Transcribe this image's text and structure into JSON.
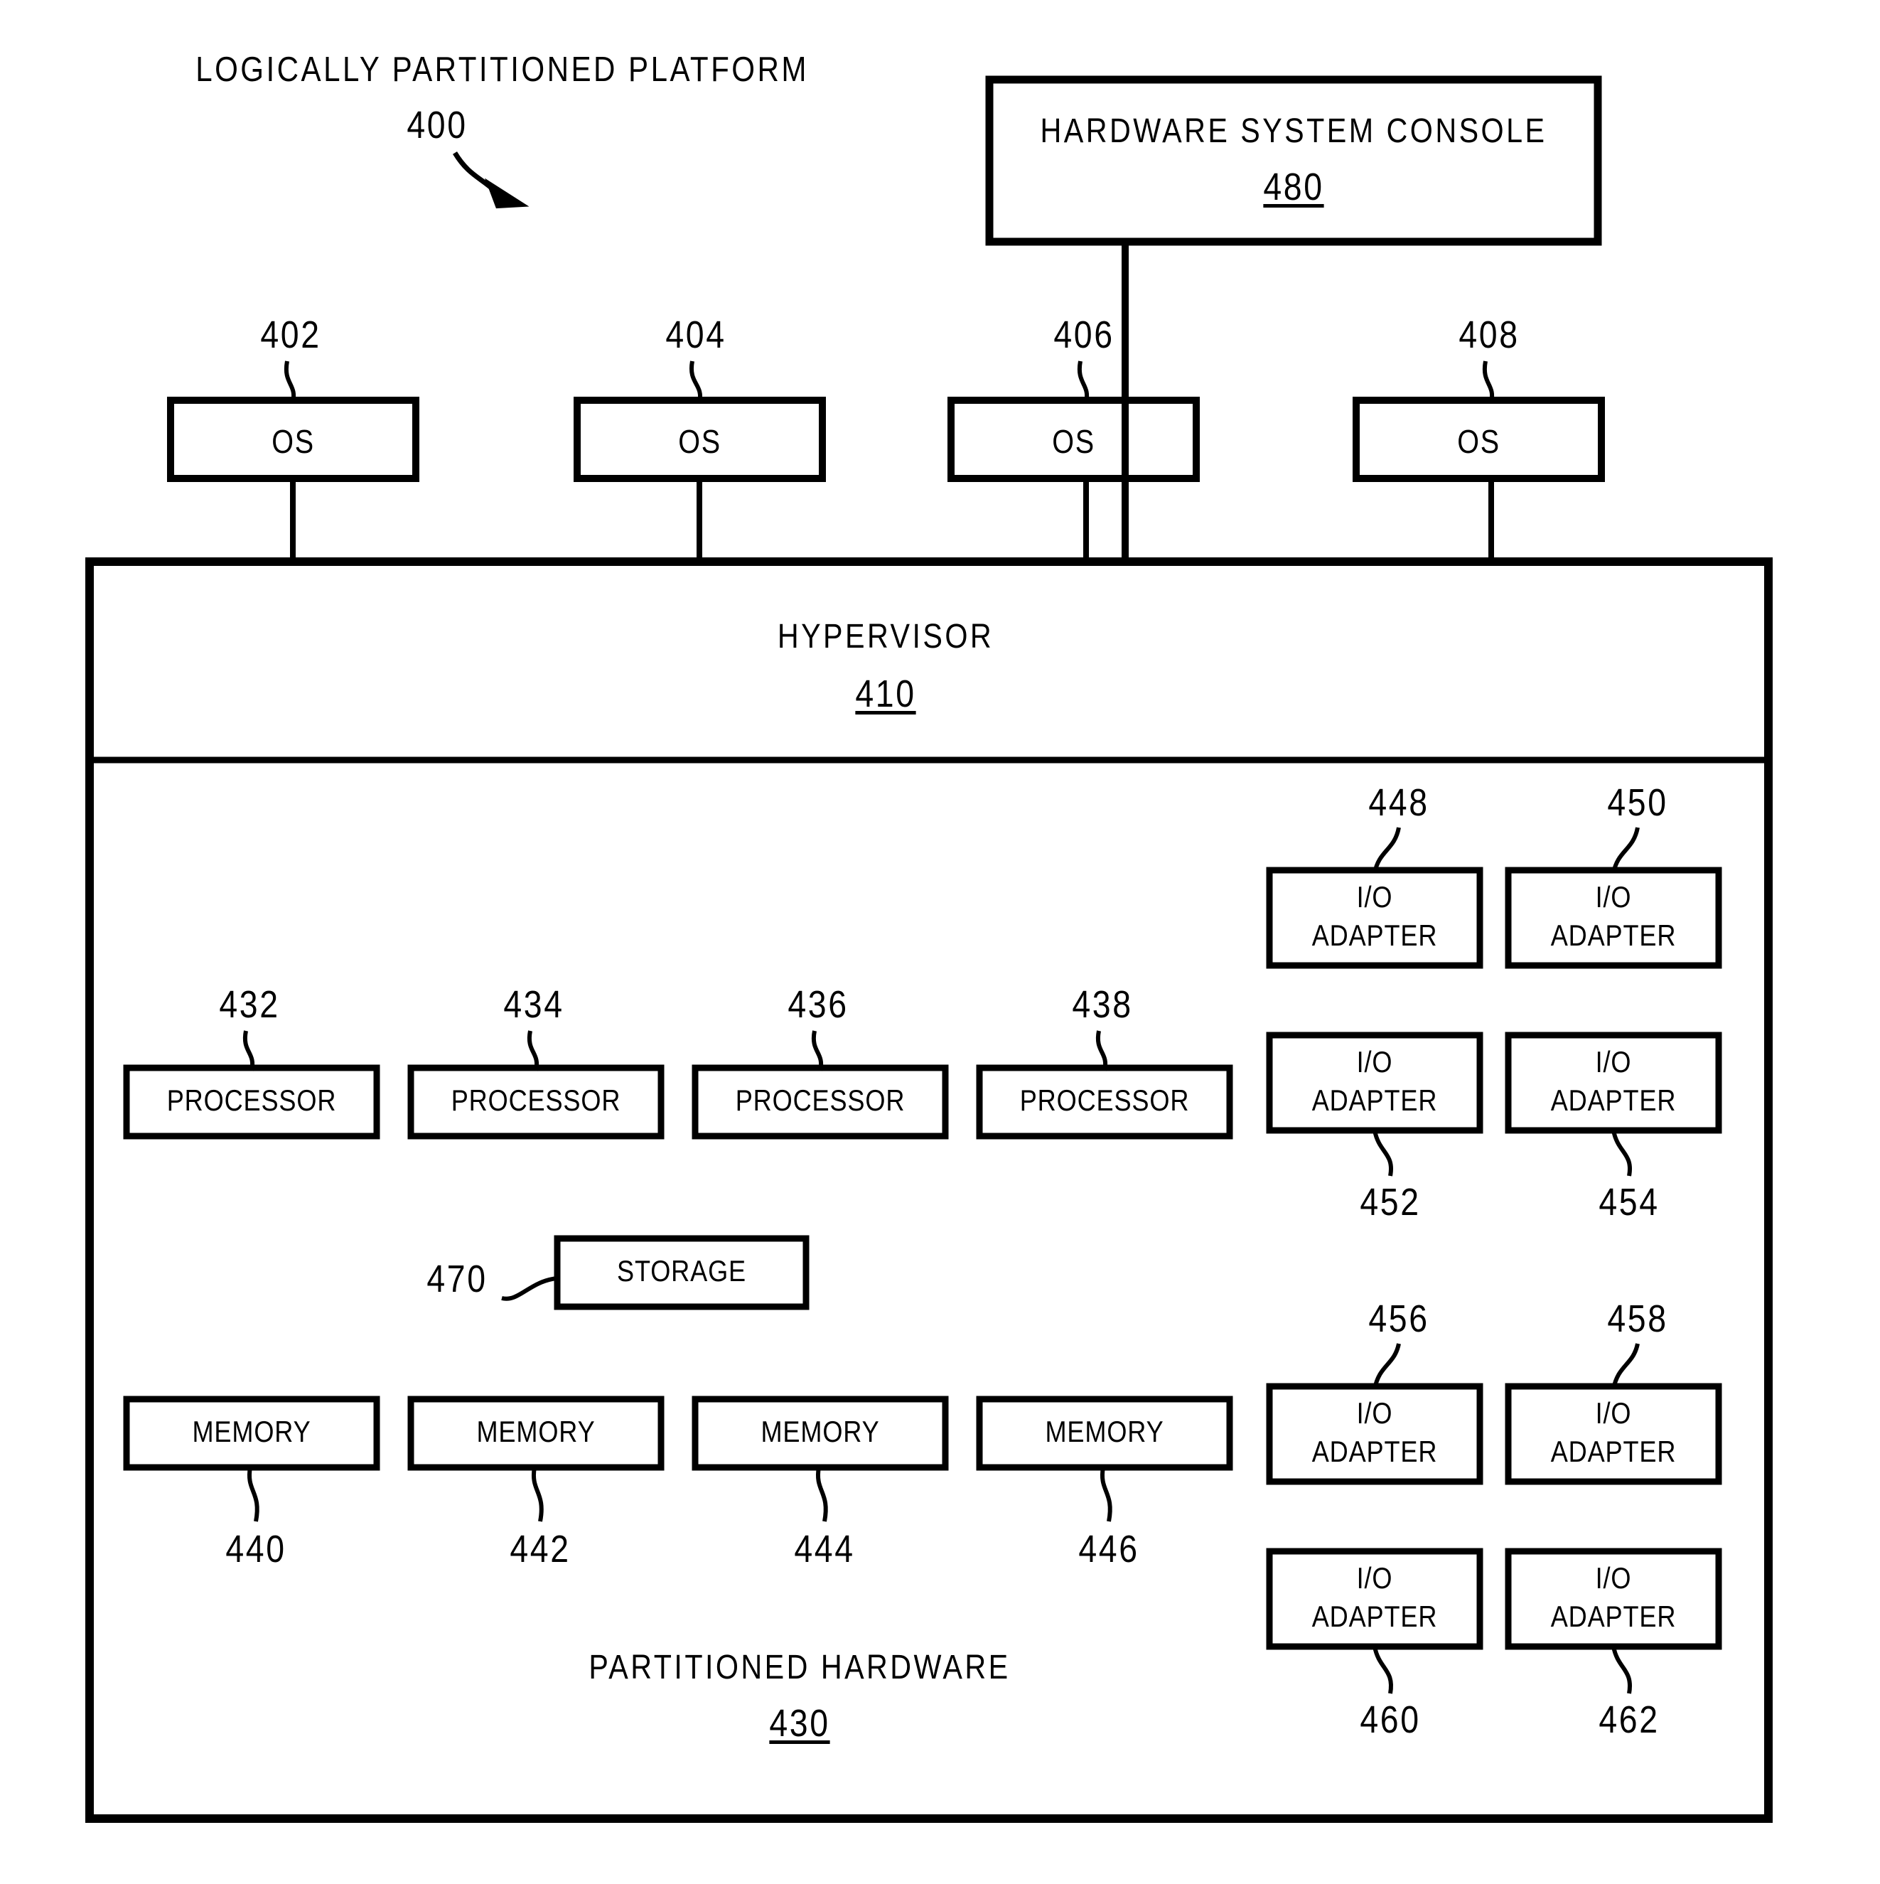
{
  "figure": {
    "title": "LOGICALLY PARTITIONED PLATFORM",
    "title_ref": "400"
  },
  "console": {
    "label": "HARDWARE SYSTEM CONSOLE",
    "ref": "480"
  },
  "os_row": {
    "label": "OS",
    "items": [
      {
        "ref": "402",
        "label": "OS"
      },
      {
        "ref": "404",
        "label": "OS"
      },
      {
        "ref": "406",
        "label": "OS"
      },
      {
        "ref": "408",
        "label": "OS"
      }
    ]
  },
  "hypervisor": {
    "label": "HYPERVISOR",
    "ref": "410"
  },
  "partitioned_hardware": {
    "label": "PARTITIONED HARDWARE",
    "ref": "430"
  },
  "processors": [
    {
      "ref": "432",
      "label": "PROCESSOR"
    },
    {
      "ref": "434",
      "label": "PROCESSOR"
    },
    {
      "ref": "436",
      "label": "PROCESSOR"
    },
    {
      "ref": "438",
      "label": "PROCESSOR"
    }
  ],
  "storage": {
    "ref": "470",
    "label": "STORAGE"
  },
  "memories": [
    {
      "ref": "440",
      "label": "MEMORY"
    },
    {
      "ref": "442",
      "label": "MEMORY"
    },
    {
      "ref": "444",
      "label": "MEMORY"
    },
    {
      "ref": "446",
      "label": "MEMORY"
    }
  ],
  "io_adapters": [
    {
      "ref": "448",
      "line1": "I/O",
      "line2": "ADAPTER"
    },
    {
      "ref": "450",
      "line1": "I/O",
      "line2": "ADAPTER"
    },
    {
      "ref": "452",
      "line1": "I/O",
      "line2": "ADAPTER"
    },
    {
      "ref": "454",
      "line1": "I/O",
      "line2": "ADAPTER"
    },
    {
      "ref": "456",
      "line1": "I/O",
      "line2": "ADAPTER"
    },
    {
      "ref": "458",
      "line1": "I/O",
      "line2": "ADAPTER"
    },
    {
      "ref": "460",
      "line1": "I/O",
      "line2": "ADAPTER"
    },
    {
      "ref": "462",
      "line1": "I/O",
      "line2": "ADAPTER"
    }
  ],
  "colors": {
    "ink": "#000000",
    "paper": "#ffffff"
  }
}
